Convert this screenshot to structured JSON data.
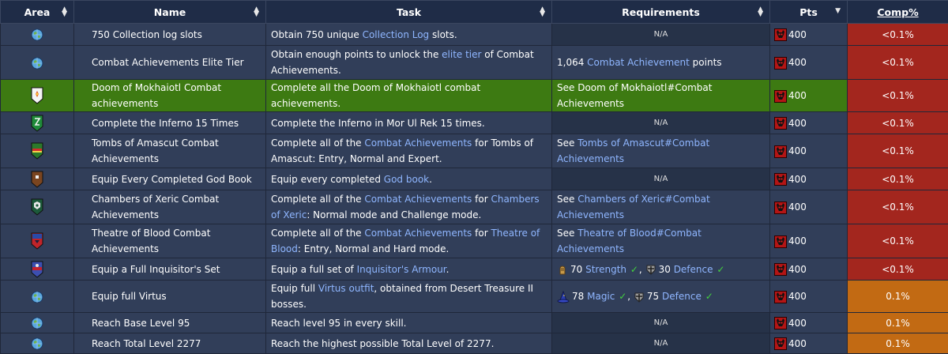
{
  "headers": {
    "area": "Area",
    "name": "Name",
    "task": "Task",
    "requirements": "Requirements",
    "pts": "Pts",
    "comp": "Comp%"
  },
  "colors": {
    "header_bg": "#1f2c47",
    "row_bg": "#313e59",
    "highlight_row": "#3d7a12",
    "link": "#8fb6ff",
    "comp_red": "#a3261e",
    "comp_orange": "#c26a13",
    "check": "#43d13f"
  },
  "rows": [
    {
      "area_icon": "globe-icon",
      "name": "750 Collection log slots",
      "task": [
        "Obtain 750 unique ",
        "Collection Log",
        " slots."
      ],
      "req_na": "N/A",
      "pts": "400",
      "comp": "<0.1%"
    },
    {
      "area_icon": "globe-icon",
      "name": "Combat Achievements Elite Tier",
      "task": [
        "Obtain enough points to unlock the ",
        "elite tier",
        " of Combat Achievements."
      ],
      "req": [
        "1,064 ",
        "Combat Achievement",
        " points"
      ],
      "pts": "400",
      "comp": "<0.1%"
    },
    {
      "area_icon": "doom-shield-icon",
      "name": "Doom of Mokhaiotl Combat achievements",
      "task": [
        "Complete all the Doom of Mokhaiotl combat achievements."
      ],
      "req": [
        "See Doom of Mokhaiotl#Combat Achievements"
      ],
      "pts": "400",
      "comp": "<0.1%"
    },
    {
      "area_icon": "karamja-shield-icon",
      "name": "Complete the Inferno 15 Times",
      "task": [
        "Complete the Inferno in Mor Ul Rek 15 times."
      ],
      "req_na": "N/A",
      "pts": "400",
      "comp": "<0.1%"
    },
    {
      "area_icon": "desert-shield-icon",
      "name": "Tombs of Amascut Combat Achievements",
      "task": [
        "Complete all of the ",
        "Combat Achievements",
        " for Tombs of Amascut: Entry, Normal and Expert."
      ],
      "req": [
        "See ",
        "Tombs of Amascut#Combat Achievements"
      ],
      "pts": "400",
      "comp": "<0.1%"
    },
    {
      "area_icon": "misthalin-shield-icon",
      "name": "Equip Every Completed God Book",
      "task": [
        "Equip every completed ",
        "God book",
        "."
      ],
      "req_na": "N/A",
      "pts": "400",
      "comp": "<0.1%"
    },
    {
      "area_icon": "kourend-shield-icon",
      "name": "Chambers of Xeric Combat Achievements",
      "task": [
        "Complete all of the ",
        "Combat Achievements",
        " for ",
        "Chambers of Xeric",
        ": Normal mode and Challenge mode."
      ],
      "req": [
        "See ",
        "Chambers of Xeric#Combat Achievements"
      ],
      "pts": "400",
      "comp": "<0.1%"
    },
    {
      "area_icon": "morytania-shield-icon",
      "name": "Theatre of Blood Combat Achievements",
      "task": [
        "Complete all of the ",
        "Combat Achievements",
        " for ",
        "Theatre of Blood",
        ": Entry, Normal and Hard mode."
      ],
      "req": [
        "See ",
        "Theatre of Blood#Combat Achievements"
      ],
      "pts": "400",
      "comp": "<0.1%"
    },
    {
      "area_icon": "varlamore-shield-icon",
      "name": "Equip a Full Inquisitor's Set",
      "task": [
        "Equip a full set of ",
        "Inquisitor's Armour",
        "."
      ],
      "skills": [
        {
          "icon": "strength-icon",
          "level": "70",
          "name": "Strength",
          "check": "✓",
          "sep": ","
        },
        {
          "icon": "defence-icon",
          "level": "30",
          "name": "Defence",
          "check": "✓",
          "sep": ""
        }
      ],
      "pts": "400",
      "comp": "<0.1%"
    },
    {
      "area_icon": "globe-icon",
      "name": "Equip full Virtus",
      "task": [
        "Equip full ",
        "Virtus outfit",
        ", obtained from Desert Treasure II bosses."
      ],
      "skills": [
        {
          "icon": "magic-icon",
          "level": "78",
          "name": "Magic",
          "check": "✓",
          "sep": ","
        },
        {
          "icon": "defence-icon",
          "level": "75",
          "name": "Defence",
          "check": "✓",
          "sep": ""
        }
      ],
      "pts": "400",
      "comp": "0.1%"
    },
    {
      "area_icon": "globe-icon",
      "name": "Reach Base Level 95",
      "task": [
        "Reach level 95 in every skill."
      ],
      "req_na": "N/A",
      "pts": "400",
      "comp": "0.1%"
    },
    {
      "area_icon": "globe-icon",
      "name": "Reach Total Level 2277",
      "task": [
        "Reach the highest possible Total Level of 2277."
      ],
      "req_na": "N/A",
      "pts": "400",
      "comp": "0.1%"
    }
  ]
}
